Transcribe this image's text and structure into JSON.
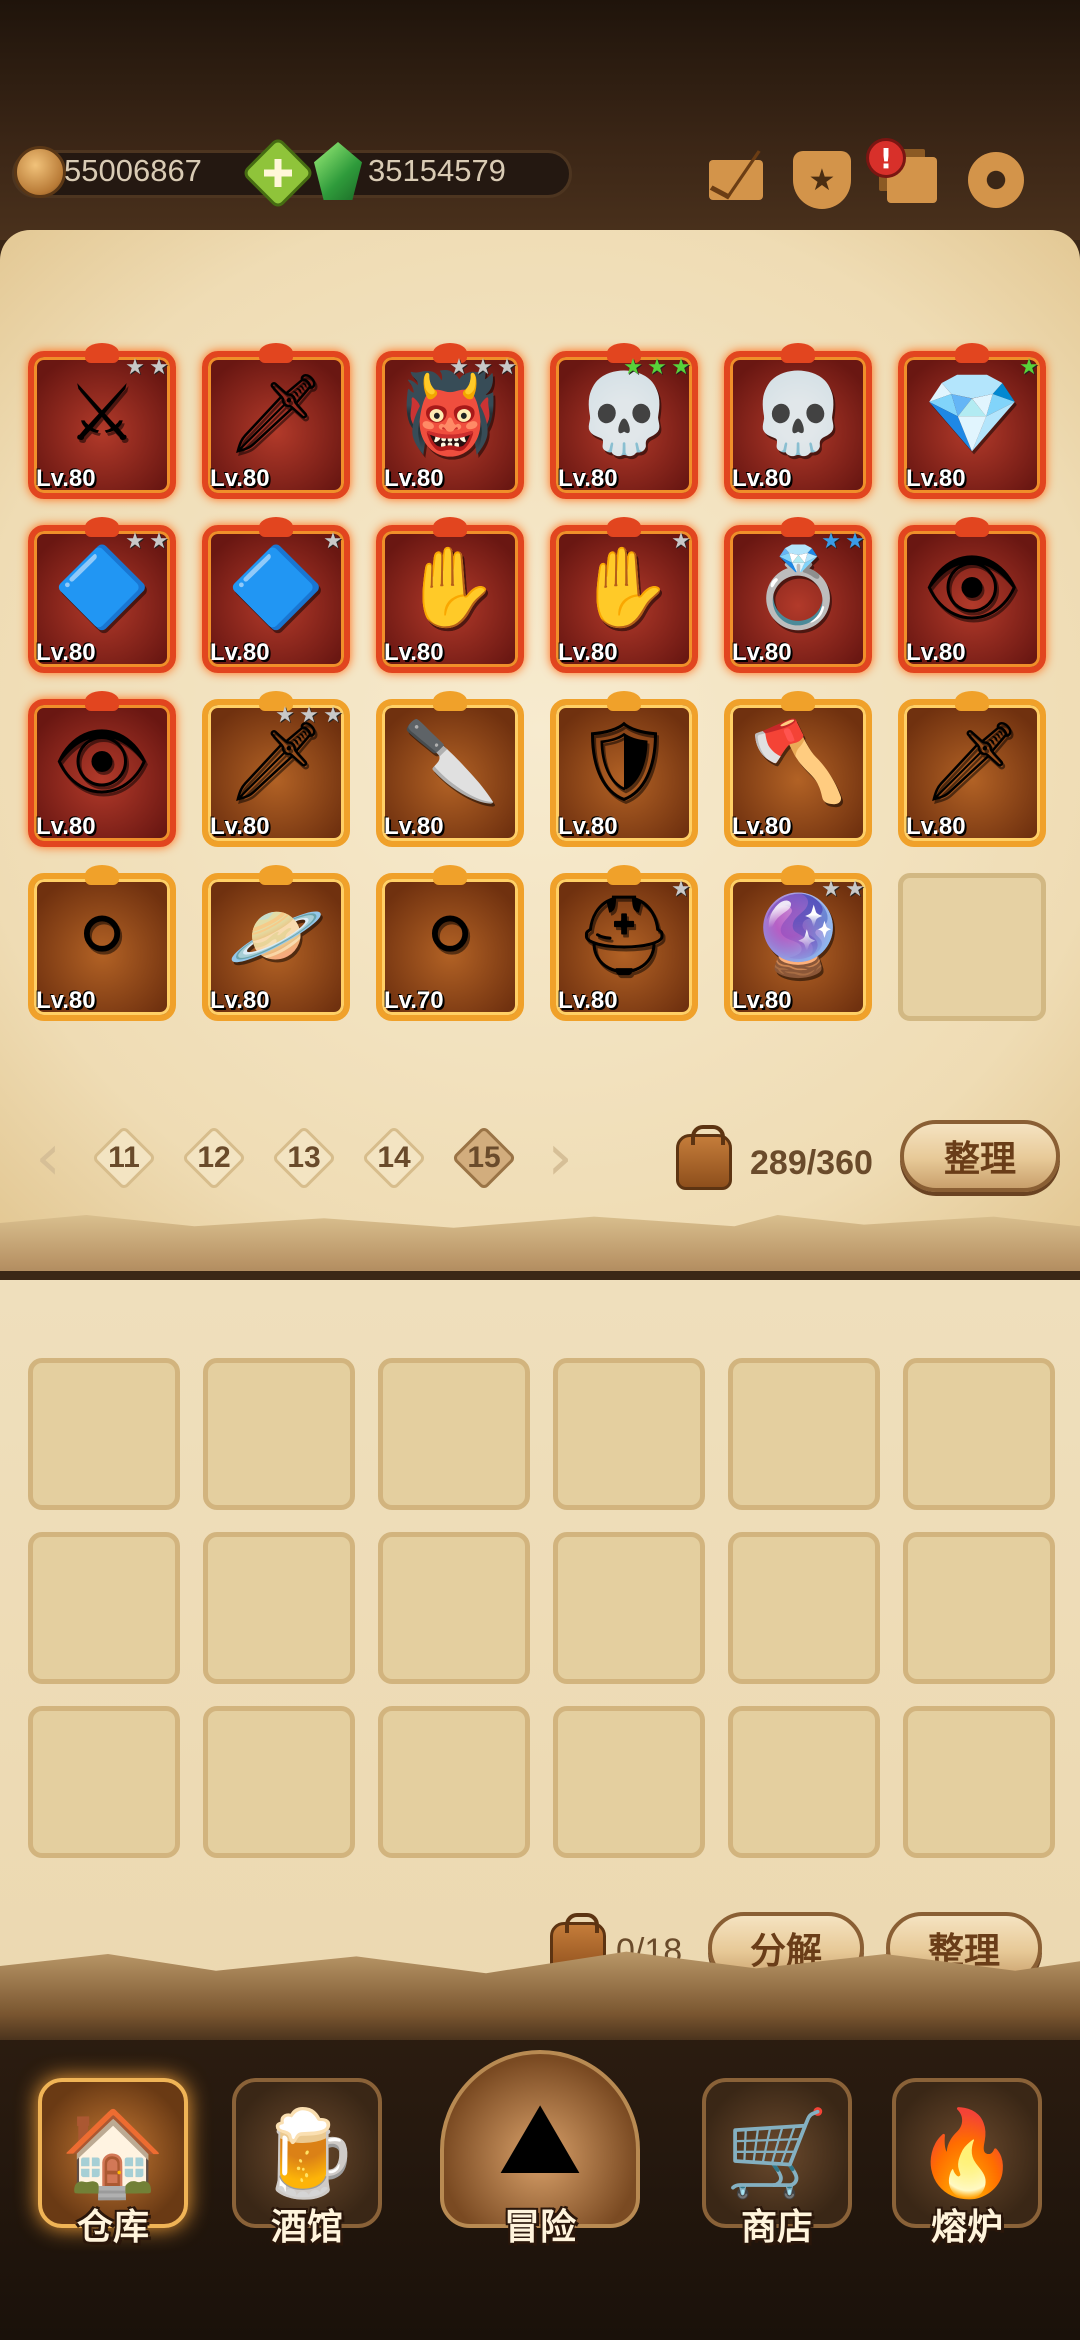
{
  "resources": {
    "gold": "55006867",
    "gems": "35154579"
  },
  "top_icons": [
    "mail-icon",
    "favorites-icon",
    "layers-icon",
    "gear-icon"
  ],
  "alert_badge": "!",
  "inventory": {
    "items": [
      {
        "icon": "scythe-icon",
        "glyph": "⚔",
        "level": "Lv.80",
        "rarity": "red",
        "stars": [
          "silver",
          "silver"
        ]
      },
      {
        "icon": "fang-blade-icon",
        "glyph": "🗡",
        "level": "Lv.80",
        "rarity": "red",
        "stars": []
      },
      {
        "icon": "demon-helm-icon",
        "glyph": "👹",
        "level": "Lv.80",
        "rarity": "red",
        "stars": [
          "silver",
          "silver",
          "silver"
        ]
      },
      {
        "icon": "hooded-skull-helm-icon",
        "glyph": "💀",
        "level": "Lv.80",
        "rarity": "red",
        "stars": [
          "green",
          "green",
          "green"
        ]
      },
      {
        "icon": "hooded-skull-helm-icon",
        "glyph": "💀",
        "level": "Lv.80",
        "rarity": "red",
        "stars": []
      },
      {
        "icon": "crystal-pendant-icon",
        "glyph": "💎",
        "level": "Lv.80",
        "rarity": "red",
        "stars": [
          "green"
        ]
      },
      {
        "icon": "sapphire-amulet-icon",
        "glyph": "🔷",
        "level": "Lv.80",
        "rarity": "red",
        "stars": [
          "silver",
          "silver"
        ]
      },
      {
        "icon": "sapphire-amulet-icon",
        "glyph": "🔷",
        "level": "Lv.80",
        "rarity": "red",
        "stars": [
          "silver"
        ]
      },
      {
        "icon": "bone-gauntlet-icon",
        "glyph": "✋",
        "level": "Lv.80",
        "rarity": "red",
        "stars": []
      },
      {
        "icon": "bone-gauntlet-icon",
        "glyph": "✋",
        "level": "Lv.80",
        "rarity": "red",
        "stars": [
          "silver"
        ]
      },
      {
        "icon": "amethyst-ring-icon",
        "glyph": "💍",
        "level": "Lv.80",
        "rarity": "red",
        "stars": [
          "blue",
          "blue"
        ]
      },
      {
        "icon": "eye-ring-icon",
        "glyph": "👁",
        "level": "Lv.80",
        "rarity": "red",
        "stars": []
      },
      {
        "icon": "eye-ring-icon",
        "glyph": "👁",
        "level": "Lv.80",
        "rarity": "red",
        "stars": []
      },
      {
        "icon": "dark-sword-icon",
        "glyph": "🗡",
        "level": "Lv.80",
        "rarity": "orange",
        "stars": [
          "silver",
          "silver",
          "silver"
        ]
      },
      {
        "icon": "curved-blade-icon",
        "glyph": "🔪",
        "level": "Lv.80",
        "rarity": "orange",
        "stars": []
      },
      {
        "icon": "round-shield-icon",
        "glyph": "🛡",
        "level": "Lv.80",
        "rarity": "orange",
        "stars": []
      },
      {
        "icon": "axe-shield-icon",
        "glyph": "🪓",
        "level": "Lv.80",
        "rarity": "orange",
        "stars": []
      },
      {
        "icon": "kunai-icon",
        "glyph": "🗡",
        "level": "Lv.80",
        "rarity": "orange",
        "stars": []
      },
      {
        "icon": "silver-orb-icon",
        "glyph": "⚪",
        "level": "Lv.80",
        "rarity": "orange",
        "stars": []
      },
      {
        "icon": "planet-orb-icon",
        "glyph": "🪐",
        "level": "Lv.80",
        "rarity": "orange",
        "stars": []
      },
      {
        "icon": "silver-orb-icon",
        "glyph": "⚪",
        "level": "Lv.70",
        "rarity": "orange",
        "stars": []
      },
      {
        "icon": "knight-helm-icon",
        "glyph": "⛑",
        "level": "Lv.80",
        "rarity": "orange",
        "stars": [
          "silver"
        ]
      },
      {
        "icon": "purple-charm-icon",
        "glyph": "🔮",
        "level": "Lv.80",
        "rarity": "orange",
        "stars": [
          "silver",
          "silver"
        ]
      }
    ],
    "pages": [
      "11",
      "12",
      "13",
      "14",
      "15"
    ],
    "active_page": "15",
    "capacity": "289/360",
    "sort_label": "整理"
  },
  "salvage": {
    "capacity": "0/18",
    "salvage_label": "分解",
    "sort_label": "整理"
  },
  "bottom_nav": [
    {
      "label": "仓库",
      "icon": "warehouse-icon",
      "glyph": "🏠",
      "active": true
    },
    {
      "label": "酒馆",
      "icon": "tavern-mug-icon",
      "glyph": "🍺",
      "active": false
    },
    {
      "label": "冒险",
      "icon": "adventure-icon",
      "glyph": "⛰",
      "active": false
    },
    {
      "label": "商店",
      "icon": "shop-icon",
      "glyph": "🛒",
      "active": false
    },
    {
      "label": "熔炉",
      "icon": "forge-icon",
      "glyph": "🔥",
      "active": false
    }
  ]
}
